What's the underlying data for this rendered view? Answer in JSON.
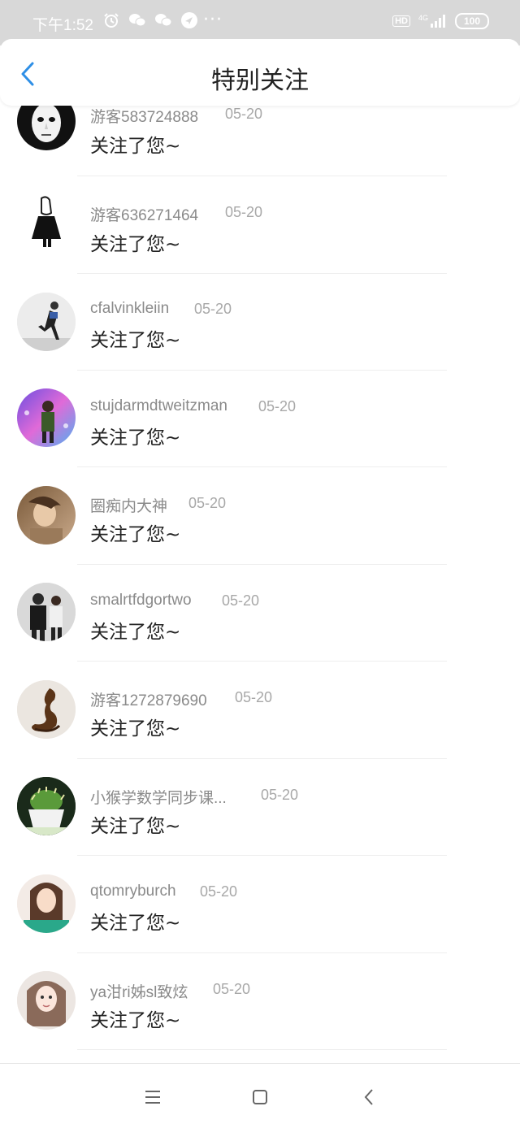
{
  "status_bar": {
    "time": "下午1:52",
    "more_dots": "···",
    "hd": "HD",
    "network": "4G",
    "battery": "100"
  },
  "header": {
    "title": "特别关注"
  },
  "list": [
    {
      "name": "游客583724888",
      "date": "05-20",
      "message": "关注了您~",
      "avatar": "mask-avatar"
    },
    {
      "name": "游客636271464",
      "date": "05-20",
      "message": "关注了您~",
      "avatar": "figure-avatar"
    },
    {
      "name": "cfalvinkleiin",
      "date": "05-20",
      "message": "关注了您~",
      "avatar": "runner-avatar"
    },
    {
      "name": "stujdarmdtweitzman",
      "date": "05-20",
      "message": "关注了您~",
      "avatar": "neon-avatar"
    },
    {
      "name": "圈痴内大神",
      "date": "05-20",
      "message": "关注了您~",
      "avatar": "portrait-avatar"
    },
    {
      "name": "smalrtfdgortwo",
      "date": "05-20",
      "message": "关注了您~",
      "avatar": "couple-avatar"
    },
    {
      "name": "游客1272879690",
      "date": "05-20",
      "message": "关注了您~",
      "avatar": "sculpture-avatar"
    },
    {
      "name": "小猴学数学同步课...",
      "date": "05-20",
      "message": "关注了您~",
      "avatar": "cactus-avatar"
    },
    {
      "name": "qtomryburch",
      "date": "05-20",
      "message": "关注了您~",
      "avatar": "girl-avatar"
    },
    {
      "name": "ya泔ri姊sl致炫",
      "date": "05-20",
      "message": "关注了您~",
      "avatar": "girl2-avatar"
    }
  ],
  "colors": {
    "accent": "#2e8fe6",
    "status_bar_bg": "#d8d8d8",
    "name_gray": "#8a8a8a",
    "date_gray": "#a8a8a8"
  },
  "system_nav": {
    "icons": [
      "menu-icon",
      "home-square-icon",
      "back-chevron-icon"
    ]
  }
}
